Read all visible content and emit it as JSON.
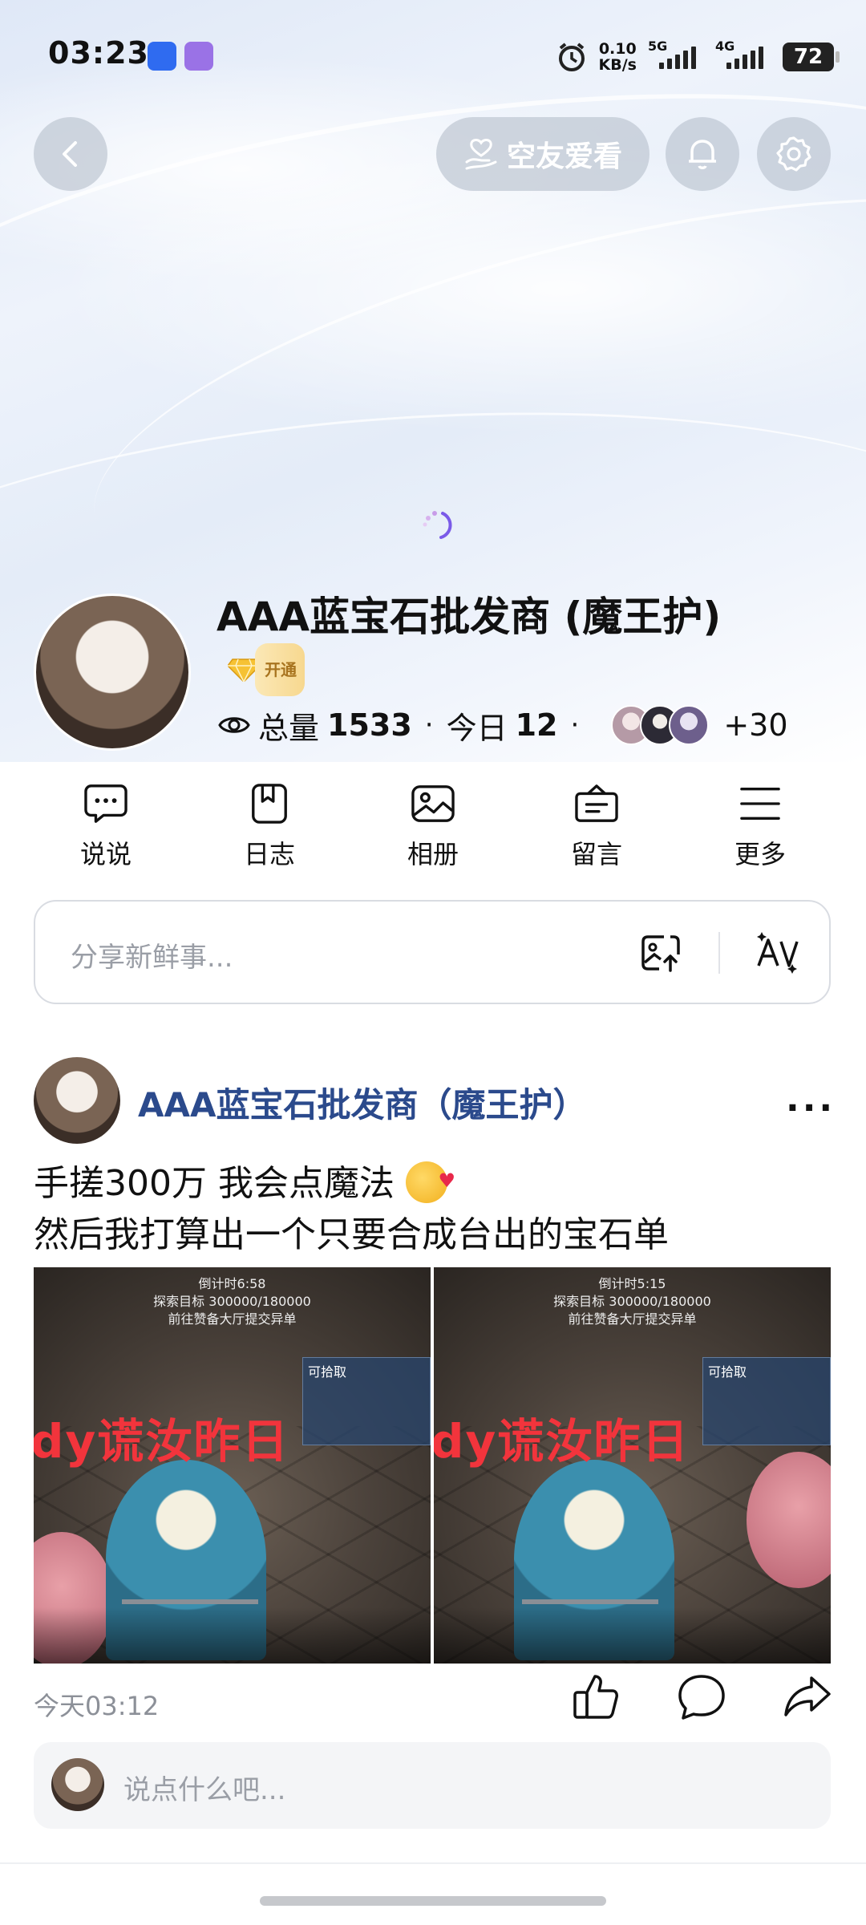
{
  "status_bar": {
    "time": "03:23",
    "net_speed_value": "0.10",
    "net_speed_unit": "KB/s",
    "sim1_label": "5G",
    "sim2_label": "4G",
    "battery": "72"
  },
  "header": {
    "back_icon": "chevron-left-icon",
    "friend_button_label": "空友爱看",
    "bell_icon": "bell-icon",
    "settings_icon": "gear-icon"
  },
  "profile": {
    "name": "AAA蓝宝石批发商 (魔王护)",
    "vip_label": "开通",
    "total_label": "总量",
    "total_value": "1533",
    "today_label": "今日",
    "today_value": "12",
    "visitors_extra": "+30"
  },
  "nav": {
    "items": [
      {
        "label": "说说",
        "icon": "chat-bubble-icon"
      },
      {
        "label": "日志",
        "icon": "bookmark-icon"
      },
      {
        "label": "相册",
        "icon": "image-icon"
      },
      {
        "label": "留言",
        "icon": "message-box-icon"
      },
      {
        "label": "更多",
        "icon": "menu-icon"
      }
    ]
  },
  "share": {
    "placeholder": "分享新鲜事..."
  },
  "post": {
    "author": "AAA蓝宝石批发商（魔王护）",
    "line1": "手搓300万 我会点魔法",
    "line2": "然后我打算出一个只要合成台出的宝石单",
    "images": [
      {
        "hud_timer": "倒计时6:58",
        "hud_target": "探索目标 300000/180000",
        "hud_sub": "前往赞备大厅提交异单",
        "watermark": "dy谎汝昨日",
        "card_label": "可拾取"
      },
      {
        "hud_timer": "倒计时5:15",
        "hud_target": "探索目标 300000/180000",
        "hud_sub": "前往赞备大厅提交异单",
        "watermark": "dy谎汝昨日",
        "card_label": "可拾取"
      }
    ],
    "time": "今天03:12",
    "comment_placeholder": "说点什么吧..."
  },
  "colors": {
    "author_blue": "#2b4a8c",
    "watermark_red": "#f2343c",
    "vip_gold": "#f7d88f"
  }
}
